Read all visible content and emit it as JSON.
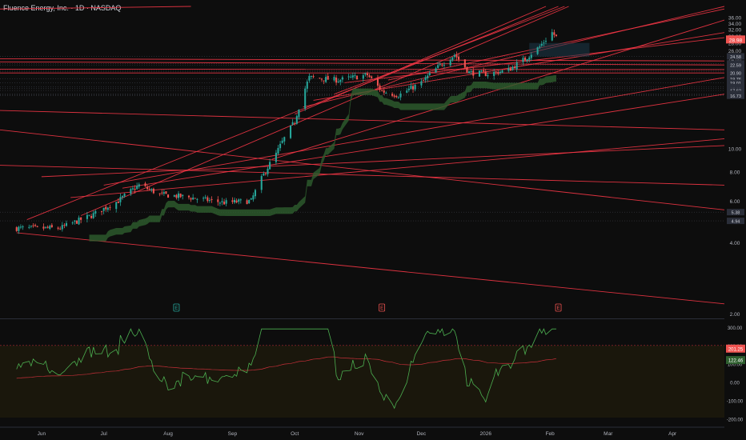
{
  "header": {
    "title": "Fluence Energy, Inc. · 1D · NASDAQ"
  },
  "colors": {
    "background": "#0d0d0d",
    "up": "#26a69a",
    "down": "#ef5350",
    "trendline": "#f23645",
    "oscillator": "#4caf50",
    "cloud": "#2e5e2e",
    "box": "#1e3a4a"
  },
  "chart_data": {
    "type": "candlestick",
    "price_axis": {
      "scale": "log",
      "ticks": [
        "36.00",
        "34.00",
        "32.00",
        "30.00",
        "28.00",
        "26.00",
        "24.00",
        "10.00",
        "8.00",
        "6.00",
        "4.00",
        "2.00"
      ],
      "levels": [
        "24.58",
        "22.93",
        "22.59",
        "21.47",
        "21.18",
        "20.90",
        "19.76",
        "19.01",
        "18.23",
        "17.95",
        "17.62",
        "17.05",
        "16.86",
        "16.73",
        "5.38",
        "4.94"
      ],
      "last_price": "28.98"
    },
    "time_axis": {
      "labels": [
        "Jun",
        "Jul",
        "Aug",
        "Sep",
        "Oct",
        "Nov",
        "Dec",
        "2026",
        "Feb",
        "Mar",
        "Apr"
      ]
    },
    "indicator": {
      "ticks": [
        "300.00",
        "200.00",
        "100.00",
        "0.00",
        "-100.00",
        "-200.00"
      ],
      "ylim": [
        -220,
        330
      ],
      "overbought": 200,
      "current_value": "201.25",
      "signal_value": "122.46"
    },
    "earnings_markers": [
      {
        "date": "2025-08-05",
        "label": "E",
        "color": "up"
      },
      {
        "date": "2025-11-12",
        "label": "E",
        "color": "down"
      },
      {
        "date": "2026-02-05",
        "label": "E",
        "color": "down"
      }
    ],
    "close_anchors": [
      [
        "2025-05-20",
        4.6
      ],
      [
        "2025-06-10",
        4.6
      ],
      [
        "2025-06-25",
        5.2
      ],
      [
        "2025-07-08",
        6.0
      ],
      [
        "2025-07-18",
        7.0
      ],
      [
        "2025-07-28",
        6.4
      ],
      [
        "2025-08-12",
        6.2
      ],
      [
        "2025-08-28",
        5.9
      ],
      [
        "2025-09-10",
        6.0
      ],
      [
        "2025-09-22",
        9.5
      ],
      [
        "2025-10-01",
        13.0
      ],
      [
        "2025-10-08",
        20.0
      ],
      [
        "2025-10-22",
        19.5
      ],
      [
        "2025-11-05",
        20.5
      ],
      [
        "2025-11-12",
        17.5
      ],
      [
        "2025-11-20",
        16.8
      ],
      [
        "2025-12-01",
        19.0
      ],
      [
        "2025-12-10",
        22.5
      ],
      [
        "2025-12-17",
        25.0
      ],
      [
        "2025-12-24",
        21.0
      ],
      [
        "2026-01-02",
        20.7
      ],
      [
        "2026-01-12",
        21.5
      ],
      [
        "2026-01-20",
        24.0
      ],
      [
        "2026-01-27",
        27.0
      ],
      [
        "2026-02-02",
        31.0
      ],
      [
        "2026-02-05",
        29.0
      ]
    ]
  }
}
